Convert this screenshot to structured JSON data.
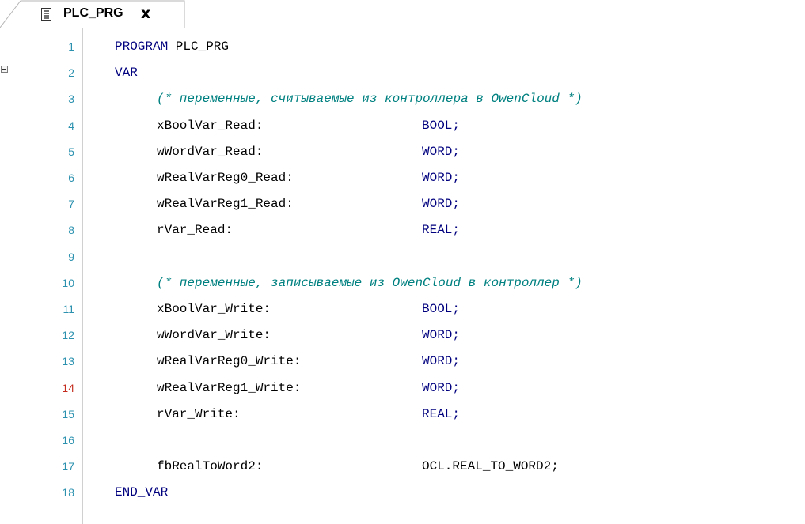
{
  "tab": {
    "title": "PLC_PRG",
    "close": "x",
    "icon": "document-icon"
  },
  "colors": {
    "line_number": "#2b91af",
    "line_number_marked": "#c42b1c",
    "keyword": "#00007f",
    "comment": "#008080",
    "text": "#000000"
  },
  "lines": [
    {
      "n": "1",
      "kw": "PROGRAM",
      "text": " PLC_PRG"
    },
    {
      "n": "2",
      "kw": "VAR"
    },
    {
      "n": "3",
      "comment": "(* переменные, считываемые из контроллера в OwenCloud *)"
    },
    {
      "n": "4",
      "name": "xBoolVar_Read:",
      "type": "BOOL;"
    },
    {
      "n": "5",
      "name": "wWordVar_Read:",
      "type": "WORD;"
    },
    {
      "n": "6",
      "name": "wRealVarReg0_Read:",
      "type": "WORD;"
    },
    {
      "n": "7",
      "name": "wRealVarReg1_Read:",
      "type": "WORD;"
    },
    {
      "n": "8",
      "name": "rVar_Read:",
      "type": "REAL;"
    },
    {
      "n": "9"
    },
    {
      "n": "10",
      "comment": "(* переменные, записываемые из OwenCloud в контроллер *)"
    },
    {
      "n": "11",
      "name": "xBoolVar_Write:",
      "type": "BOOL;"
    },
    {
      "n": "12",
      "name": "wWordVar_Write:",
      "type": "WORD;"
    },
    {
      "n": "13",
      "name": "wRealVarReg0_Write:",
      "type": "WORD;"
    },
    {
      "n": "14",
      "name": "wRealVarReg1_Write:",
      "type": "WORD;",
      "marked": true
    },
    {
      "n": "15",
      "name": "rVar_Write:",
      "type": "REAL;"
    },
    {
      "n": "16"
    },
    {
      "n": "17",
      "name": "fbRealToWord2:",
      "type": "OCL.REAL_TO_WORD2;",
      "plain_type": true
    },
    {
      "n": "18",
      "kw": "END_VAR"
    }
  ]
}
